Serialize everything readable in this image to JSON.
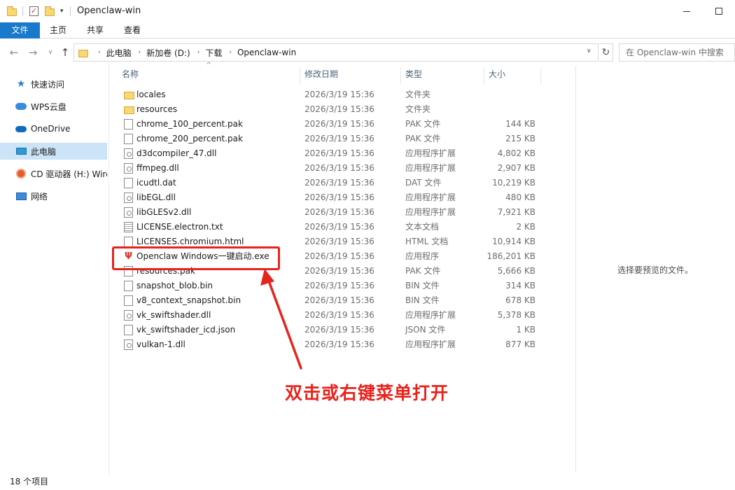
{
  "window": {
    "title": "Openclaw-win",
    "qa_icons": [
      "folder-icon",
      "properties-check-icon",
      "new-folder-icon",
      "customize-dropdown-icon"
    ]
  },
  "ribbon": {
    "tabs": [
      {
        "label": "文件",
        "active": true
      },
      {
        "label": "主页"
      },
      {
        "label": "共享"
      },
      {
        "label": "查看"
      }
    ]
  },
  "address": {
    "breadcrumbs": [
      "此电脑",
      "新加卷 (D:)",
      "下载",
      "Openclaw-win"
    ],
    "search_placeholder": "在 Openclaw-win 中搜索"
  },
  "nav": {
    "items": [
      {
        "label": "快速访问",
        "icon": "star-icon"
      },
      {
        "label": "WPS云盘",
        "icon": "wps-cloud-icon"
      },
      {
        "label": "OneDrive",
        "icon": "onedrive-icon"
      },
      {
        "label": "此电脑",
        "icon": "this-pc-icon",
        "selected": true
      },
      {
        "label": "CD 驱动器 (H:) Wire",
        "icon": "cd-drive-icon"
      },
      {
        "label": "网络",
        "icon": "network-icon"
      }
    ]
  },
  "columns": {
    "name": "名称",
    "date": "修改日期",
    "type": "类型",
    "size": "大小"
  },
  "files": [
    {
      "name": "locales",
      "date": "2026/3/19 15:36",
      "type": "文件夹",
      "size": "",
      "icon": "folder"
    },
    {
      "name": "resources",
      "date": "2026/3/19 15:36",
      "type": "文件夹",
      "size": "",
      "icon": "folder"
    },
    {
      "name": "chrome_100_percent.pak",
      "date": "2026/3/19 15:36",
      "type": "PAK 文件",
      "size": "144 KB",
      "icon": "doc"
    },
    {
      "name": "chrome_200_percent.pak",
      "date": "2026/3/19 15:36",
      "type": "PAK 文件",
      "size": "215 KB",
      "icon": "doc"
    },
    {
      "name": "d3dcompiler_47.dll",
      "date": "2026/3/19 15:36",
      "type": "应用程序扩展",
      "size": "4,802 KB",
      "icon": "dll"
    },
    {
      "name": "ffmpeg.dll",
      "date": "2026/3/19 15:36",
      "type": "应用程序扩展",
      "size": "2,907 KB",
      "icon": "dll"
    },
    {
      "name": "icudtl.dat",
      "date": "2026/3/19 15:36",
      "type": "DAT 文件",
      "size": "10,219 KB",
      "icon": "doc"
    },
    {
      "name": "libEGL.dll",
      "date": "2026/3/19 15:36",
      "type": "应用程序扩展",
      "size": "480 KB",
      "icon": "dll"
    },
    {
      "name": "libGLESv2.dll",
      "date": "2026/3/19 15:36",
      "type": "应用程序扩展",
      "size": "7,921 KB",
      "icon": "dll"
    },
    {
      "name": "LICENSE.electron.txt",
      "date": "2026/3/19 15:36",
      "type": "文本文档",
      "size": "2 KB",
      "icon": "txt"
    },
    {
      "name": "LICENSES.chromium.html",
      "date": "2026/3/19 15:36",
      "type": "HTML 文档",
      "size": "10,914 KB",
      "icon": "doc"
    },
    {
      "name": "Openclaw Windows一键启动.exe",
      "date": "2026/3/19 15:36",
      "type": "应用程序",
      "size": "186,201 KB",
      "icon": "exe"
    },
    {
      "name": "resources.pak",
      "date": "2026/3/19 15:36",
      "type": "PAK 文件",
      "size": "5,666 KB",
      "icon": "doc"
    },
    {
      "name": "snapshot_blob.bin",
      "date": "2026/3/19 15:36",
      "type": "BIN 文件",
      "size": "314 KB",
      "icon": "doc"
    },
    {
      "name": "v8_context_snapshot.bin",
      "date": "2026/3/19 15:36",
      "type": "BIN 文件",
      "size": "678 KB",
      "icon": "doc"
    },
    {
      "name": "vk_swiftshader.dll",
      "date": "2026/3/19 15:36",
      "type": "应用程序扩展",
      "size": "5,378 KB",
      "icon": "dll"
    },
    {
      "name": "vk_swiftshader_icd.json",
      "date": "2026/3/19 15:36",
      "type": "JSON 文件",
      "size": "1 KB",
      "icon": "doc"
    },
    {
      "name": "vulkan-1.dll",
      "date": "2026/3/19 15:36",
      "type": "应用程序扩展",
      "size": "877 KB",
      "icon": "dll"
    }
  ],
  "preview": {
    "empty_text": "选择要预览的文件。"
  },
  "annotation": {
    "text": "双击或右键菜单打开",
    "color": "#e8231c"
  },
  "status": {
    "item_count": "18 个项目"
  },
  "colors": {
    "accent": "#1979ca",
    "selection": "#cce4f7"
  }
}
